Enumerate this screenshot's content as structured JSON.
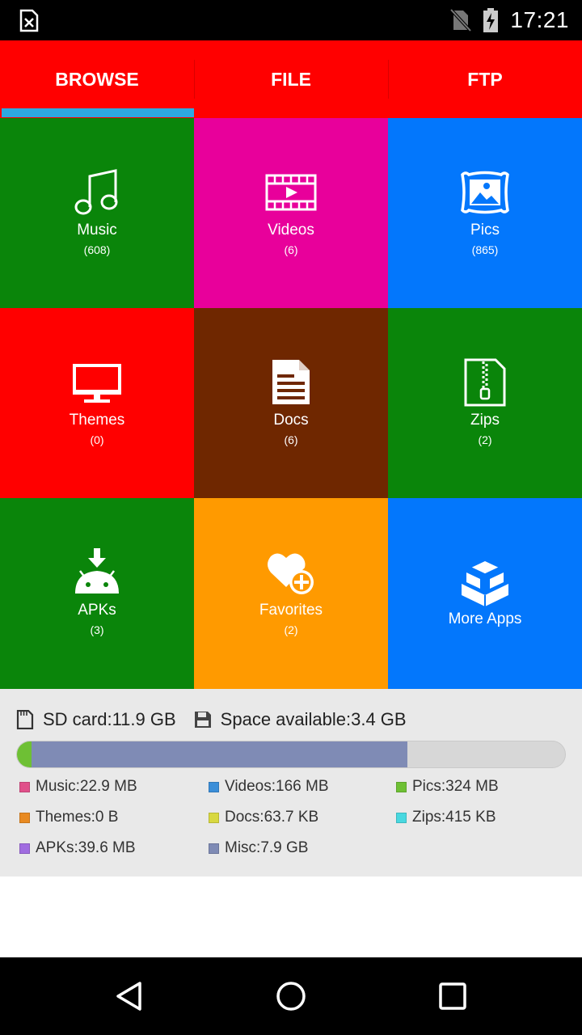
{
  "status_bar": {
    "time": "17:21",
    "icons": [
      "sim-card-error-icon",
      "no-sim-icon",
      "battery-charging-icon"
    ]
  },
  "tabs": [
    {
      "label": "BROWSE",
      "active": true
    },
    {
      "label": "FILE",
      "active": false
    },
    {
      "label": "FTP",
      "active": false
    }
  ],
  "tiles": [
    {
      "label": "Music",
      "count": "(608)",
      "color": "#0a850a",
      "icon": "music-note-icon"
    },
    {
      "label": "Videos",
      "count": "(6)",
      "color": "#e8009b",
      "icon": "film-strip-icon"
    },
    {
      "label": "Pics",
      "count": "(865)",
      "color": "#0377fc",
      "icon": "picture-frame-icon"
    },
    {
      "label": "Themes",
      "count": "(0)",
      "color": "#ff0000",
      "icon": "monitor-icon"
    },
    {
      "label": "Docs",
      "count": "(6)",
      "color": "#6f2700",
      "icon": "document-icon"
    },
    {
      "label": "Zips",
      "count": "(2)",
      "color": "#0a850a",
      "icon": "zip-file-icon"
    },
    {
      "label": "APKs",
      "count": "(3)",
      "color": "#0a850a",
      "icon": "android-download-icon"
    },
    {
      "label": "Favorites",
      "count": "(2)",
      "color": "#ff9a00",
      "icon": "heart-plus-icon"
    },
    {
      "label": "More Apps",
      "count": "",
      "color": "#0377fc",
      "icon": "boxes-icon"
    }
  ],
  "storage": {
    "sd_card": "SD card:11.9 GB",
    "space_available": "Space available:3.4 GB",
    "usage_segments": [
      {
        "name": "Pics",
        "fraction": 0.027,
        "color": "#6ec034"
      },
      {
        "name": "Misc",
        "fraction": 0.685,
        "color": "#7f8bb5"
      }
    ],
    "legend": [
      {
        "label": "Music:22.9 MB",
        "color": "#e0508a"
      },
      {
        "label": "Videos:166 MB",
        "color": "#3b8ed8"
      },
      {
        "label": "Pics:324 MB",
        "color": "#6ec034"
      },
      {
        "label": "Themes:0 B",
        "color": "#e88a22"
      },
      {
        "label": "Docs:63.7 KB",
        "color": "#d8d840"
      },
      {
        "label": "Zips:415 KB",
        "color": "#48d8e0"
      },
      {
        "label": "APKs:39.6 MB",
        "color": "#a06ce0"
      },
      {
        "label": "Misc:7.9 GB",
        "color": "#7f8bb5"
      }
    ]
  },
  "nav": {
    "back": "back-icon",
    "home": "home-icon",
    "recents": "recents-icon"
  }
}
